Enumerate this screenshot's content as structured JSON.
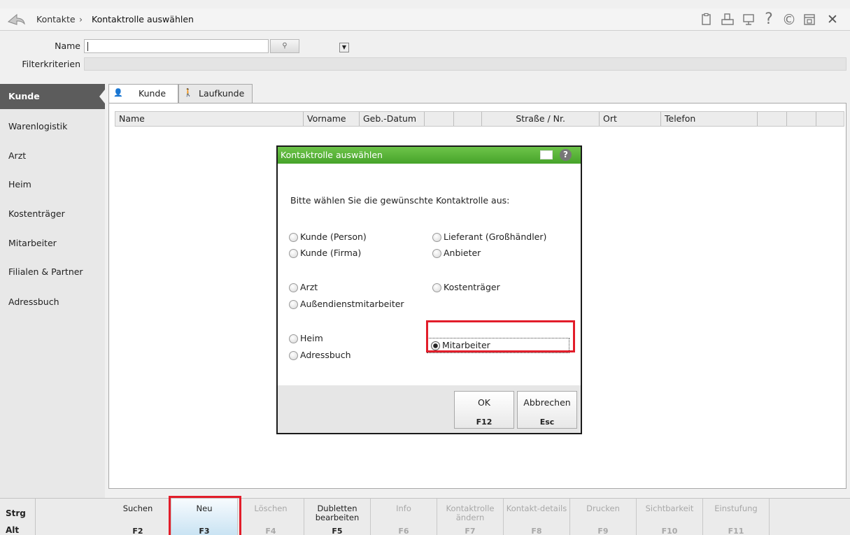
{
  "breadcrumb": {
    "root": "Kontakte",
    "separator": "›",
    "current": "Kontaktrolle auswählen"
  },
  "toolbar_icons": [
    "clipboard-icon",
    "print-icon",
    "monitor-icon",
    "help-icon",
    "eservice-icon",
    "window-icon",
    "close-icon"
  ],
  "toolbar_glyphs": {
    "help": "?",
    "eservice": "©",
    "close": "✕"
  },
  "search": {
    "name_label": "Name",
    "name_value": "",
    "filter_label": "Filterkriterien",
    "filter_value": ""
  },
  "sidebar": {
    "items": [
      {
        "label": "Kunde",
        "active": true
      },
      {
        "label": "Warenlogistik"
      },
      {
        "label": "Arzt"
      },
      {
        "label": "Heim"
      },
      {
        "label": "Kostenträger"
      },
      {
        "label": "Mitarbeiter"
      },
      {
        "label": "Filialen & Partner"
      },
      {
        "label": "Adressbuch"
      }
    ]
  },
  "tabs": [
    {
      "label": "Kunde",
      "active": true
    },
    {
      "label": "Laufkunde",
      "active": false
    }
  ],
  "grid": {
    "columns": [
      "Name",
      "Vorname",
      "Geb.-Datum",
      "",
      "",
      "Straße / Nr.",
      "Ort",
      "Telefon",
      "",
      "",
      ""
    ]
  },
  "dialog": {
    "title": "Kontaktrolle auswählen",
    "question": "Bitte wählen Sie die gewünschte Kontaktrolle aus:",
    "options": [
      {
        "label": "Kunde (Person)",
        "checked": false
      },
      {
        "label": "Kunde (Firma)",
        "checked": false
      },
      {
        "label": "Lieferant (Großhändler)",
        "checked": false
      },
      {
        "label": "Anbieter",
        "checked": false
      },
      {
        "label": "Arzt",
        "checked": false
      },
      {
        "label": "Außendienstmitarbeiter",
        "checked": false
      },
      {
        "label": "Kostenträger",
        "checked": false
      },
      {
        "label": "Heim",
        "checked": false
      },
      {
        "label": "Adressbuch",
        "checked": false
      },
      {
        "label": "Mitarbeiter",
        "checked": true
      }
    ],
    "ok_label": "OK",
    "ok_key": "F12",
    "cancel_label": "Abbrechen",
    "cancel_key": "Esc",
    "help_glyph": "?"
  },
  "modifiers": {
    "strg": "Strg",
    "alt": "Alt"
  },
  "function_keys": [
    {
      "label": "Suchen",
      "key": "F2",
      "enabled": true
    },
    {
      "label": "Neu",
      "key": "F3",
      "enabled": true,
      "highlight": true
    },
    {
      "label": "Löschen",
      "key": "F4",
      "enabled": false
    },
    {
      "label": "Dubletten bearbeiten",
      "key": "F5",
      "enabled": true
    },
    {
      "label": "Info",
      "key": "F6",
      "enabled": false
    },
    {
      "label": "Kontaktrolle ändern",
      "key": "F7",
      "enabled": false
    },
    {
      "label": "Kontakt-details",
      "key": "F8",
      "enabled": false
    },
    {
      "label": "Drucken",
      "key": "F9",
      "enabled": false
    },
    {
      "label": "Sichtbarkeit",
      "key": "F10",
      "enabled": false
    },
    {
      "label": "Einstufung",
      "key": "F11",
      "enabled": false
    }
  ],
  "colors": {
    "dialog_title": "#46a32a",
    "highlight_box": "#e21d2a",
    "sidebar_active": "#5c5c5c"
  }
}
